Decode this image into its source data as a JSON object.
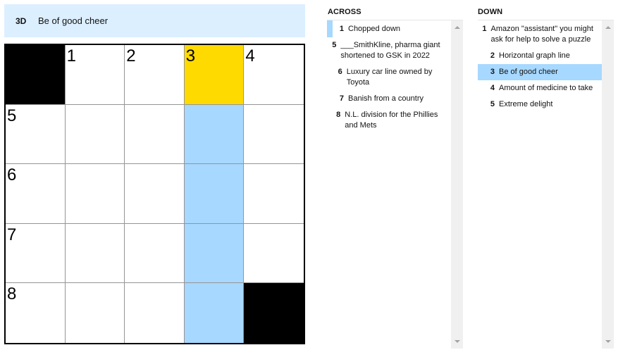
{
  "clue_bar": {
    "number": "3D",
    "text": "Be of good cheer"
  },
  "grid": {
    "rows": 5,
    "cols": 5,
    "cells": [
      [
        {
          "type": "block"
        },
        {
          "type": "open",
          "number": "1"
        },
        {
          "type": "open",
          "number": "2"
        },
        {
          "type": "active",
          "number": "3"
        },
        {
          "type": "open",
          "number": "4"
        }
      ],
      [
        {
          "type": "open",
          "number": "5"
        },
        {
          "type": "open"
        },
        {
          "type": "open"
        },
        {
          "type": "word"
        },
        {
          "type": "open"
        }
      ],
      [
        {
          "type": "open",
          "number": "6"
        },
        {
          "type": "open"
        },
        {
          "type": "open"
        },
        {
          "type": "word"
        },
        {
          "type": "open"
        }
      ],
      [
        {
          "type": "open",
          "number": "7"
        },
        {
          "type": "open"
        },
        {
          "type": "open"
        },
        {
          "type": "word"
        },
        {
          "type": "open"
        }
      ],
      [
        {
          "type": "open",
          "number": "8"
        },
        {
          "type": "open"
        },
        {
          "type": "open"
        },
        {
          "type": "word"
        },
        {
          "type": "block"
        }
      ]
    ]
  },
  "across": {
    "title": "ACROSS",
    "clues": [
      {
        "number": "1",
        "text": "Chopped down",
        "cross_highlight": true
      },
      {
        "number": "5",
        "text": "___SmithKline, pharma giant shortened to GSK in 2022"
      },
      {
        "number": "6",
        "text": "Luxury car line owned by Toyota"
      },
      {
        "number": "7",
        "text": "Banish from a country"
      },
      {
        "number": "8",
        "text": "N.L. division for the Phillies and Mets"
      }
    ]
  },
  "down": {
    "title": "DOWN",
    "clues": [
      {
        "number": "1",
        "text": "Amazon \"assistant\" you might ask for help to solve a puzzle"
      },
      {
        "number": "2",
        "text": "Horizontal graph line"
      },
      {
        "number": "3",
        "text": "Be of good cheer",
        "selected": true
      },
      {
        "number": "4",
        "text": "Amount of medicine to take"
      },
      {
        "number": "5",
        "text": "Extreme delight"
      }
    ]
  },
  "colors": {
    "active_cell": "#ffda00",
    "word_highlight": "#a7d8ff",
    "clue_bar_bg": "#dcefff"
  }
}
